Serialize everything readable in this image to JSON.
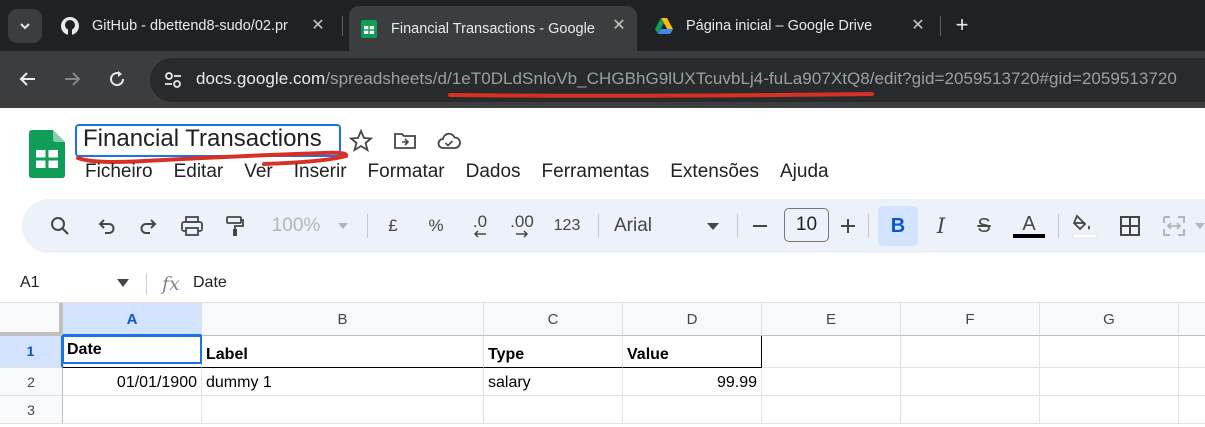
{
  "browser": {
    "tabs": [
      {
        "title": "GitHub - dbettend8-sudo/02.pr",
        "icon": "github-icon",
        "active": false
      },
      {
        "title": "Financial Transactions - Google",
        "icon": "sheets-icon",
        "active": true
      },
      {
        "title": "Página inicial – Google Drive",
        "icon": "drive-icon",
        "active": false
      }
    ],
    "close_glyph": "✕",
    "new_tab_glyph": "+",
    "url_host": "docs.google.com",
    "url_path": "/spreadsheets/d/1eT0DLdSnloVb_CHGBhG9lUXTcuvbLj4-fuLa907XtQ8/edit?gid=2059513720#gid=2059513720",
    "annotation_color": "#d93025"
  },
  "doc": {
    "title": "Financial Transactions"
  },
  "menu": [
    "Ficheiro",
    "Editar",
    "Ver",
    "Inserir",
    "Formatar",
    "Dados",
    "Ferramentas",
    "Extensões",
    "Ajuda"
  ],
  "format_toolbar": {
    "zoom": "100%",
    "currency": "£",
    "percent": "%",
    "decrease_decimal": ".0",
    "increase_decimal": ".00",
    "number_format": "123",
    "font": "Arial",
    "font_size": "10",
    "bold": "B",
    "italic": "I",
    "strike": "S",
    "text_color": "A",
    "text_color_hex": "#000000",
    "accent": "#0b57d0"
  },
  "formula_bar": {
    "cell_ref": "A1",
    "fx": "fx",
    "value": "Date"
  },
  "sheet": {
    "columns": [
      "A",
      "B",
      "C",
      "D",
      "E",
      "F",
      "G"
    ],
    "rows": [
      "1",
      "2",
      "3"
    ],
    "header_row": [
      "Date",
      "Label",
      "Type",
      "Value"
    ],
    "data_rows": [
      [
        "01/01/1900",
        "dummy 1",
        "salary",
        "99.99"
      ]
    ]
  }
}
